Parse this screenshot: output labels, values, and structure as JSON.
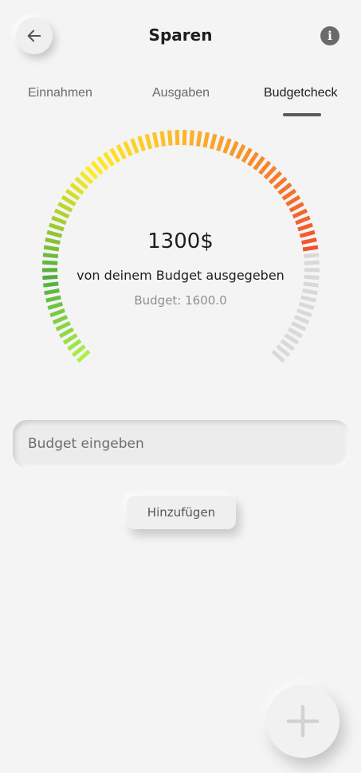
{
  "header": {
    "title": "Sparen",
    "back_icon": "arrow-left-icon",
    "info_icon": "info-icon",
    "info_glyph": "i"
  },
  "tabs": [
    {
      "label": "Einnahmen",
      "active": false
    },
    {
      "label": "Ausgaben",
      "active": false
    },
    {
      "label": "Budgetcheck",
      "active": true
    }
  ],
  "gauge": {
    "spent_text": "1300$",
    "spent_label": "von deinem Budget ausgegeben",
    "budget_text": "Budget: 1600.0",
    "spent": 1300,
    "budget": 1600,
    "filled_fraction": 0.8125,
    "colors": {
      "start": "#aef04a",
      "green": "#4fae3f",
      "yellow": "#ffee22",
      "orange": "#f9a12b",
      "red": "#f0532e",
      "empty": "#d9d9d9"
    }
  },
  "form": {
    "budget_placeholder": "Budget eingeben",
    "add_label": "Hinzufügen"
  },
  "fab": {
    "icon": "plus-icon"
  }
}
